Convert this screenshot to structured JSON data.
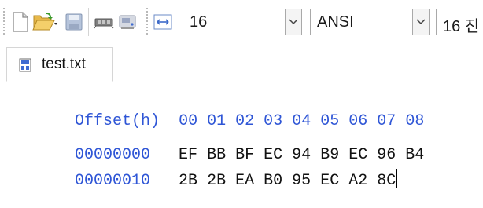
{
  "toolbar": {
    "buttons": [
      {
        "name": "new-file",
        "icon": "new-document-icon"
      },
      {
        "name": "open-file",
        "icon": "open-folder-icon"
      },
      {
        "name": "save-file",
        "icon": "save-icon"
      },
      {
        "name": "memory",
        "icon": "memory-chip-icon"
      },
      {
        "name": "disk",
        "icon": "disk-drive-icon"
      },
      {
        "name": "columns",
        "icon": "column-width-icon"
      }
    ],
    "bytes_per_row_value": "16",
    "encoding_value": "ANSI",
    "offset_base_value": "16 진"
  },
  "tabs": [
    {
      "label": "test.txt",
      "icon": "text-file-icon"
    }
  ],
  "hex_view": {
    "offset_header": "Offset(h)",
    "column_headers": [
      "00",
      "01",
      "02",
      "03",
      "04",
      "05",
      "06",
      "07",
      "08"
    ],
    "rows": [
      {
        "offset": "00000000",
        "bytes": [
          "EF",
          "BB",
          "BF",
          "EC",
          "94",
          "B9",
          "EC",
          "96",
          "B4"
        ]
      },
      {
        "offset": "00000010",
        "bytes": [
          "2B",
          "2B",
          "EA",
          "B0",
          "95",
          "EC",
          "A2",
          "8C"
        ]
      }
    ]
  },
  "colors": {
    "offset_blue": "#2f56d6",
    "byte_text": "#111111"
  }
}
